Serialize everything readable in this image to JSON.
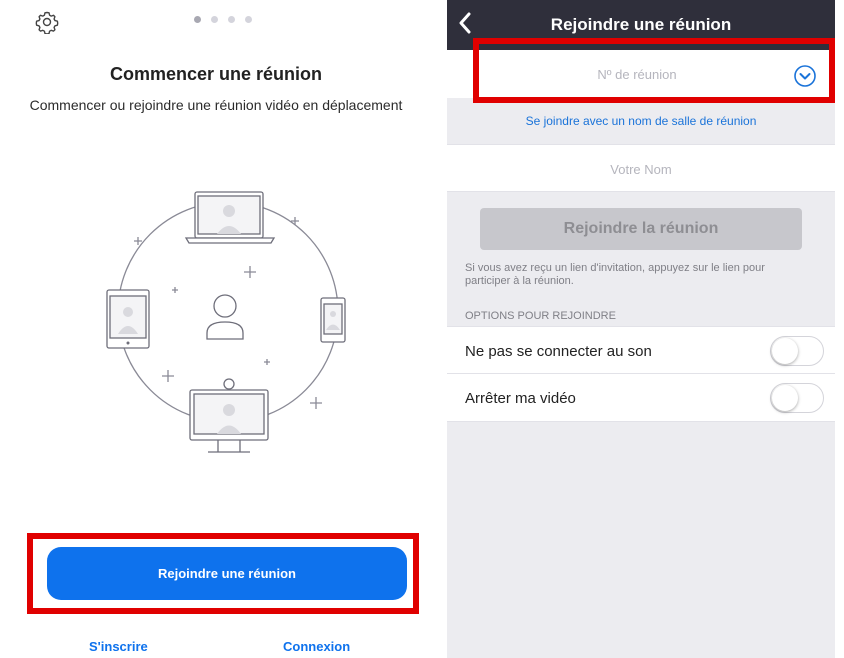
{
  "left": {
    "carousel_pages": 4,
    "carousel_active": 1,
    "title": "Commencer une réunion",
    "subtitle": "Commencer ou rejoindre une réunion vidéo en déplacement",
    "join_button": "Rejoindre une réunion",
    "signup_link": "S'inscrire",
    "login_link": "Connexion",
    "icons": [
      "gear-icon",
      "devices-illustration"
    ],
    "colors": {
      "accent": "#0e72ed",
      "highlight": "#e00000"
    }
  },
  "right": {
    "header_title": "Rejoindre une réunion",
    "meeting_number_placeholder": "Nº de réunion",
    "room_name_link": "Se joindre avec un nom de salle de réunion",
    "your_name_placeholder": "Votre Nom",
    "join_meeting_button": "Rejoindre la réunion",
    "invite_hint": "Si vous avez reçu un lien d'invitation, appuyez sur le lien pour participer à la réunion.",
    "options_section": "OPTIONS POUR REJOINDRE",
    "options": [
      {
        "label": "Ne pas se connecter au son",
        "enabled": false
      },
      {
        "label": "Arrêter ma vidéo",
        "enabled": false
      }
    ],
    "icons": [
      "back-chevron-icon",
      "history-chevron-icon"
    ],
    "colors": {
      "header_bg": "#2f2f3b",
      "link": "#1a73d9",
      "disabled_button": "#c7c7cc"
    }
  }
}
